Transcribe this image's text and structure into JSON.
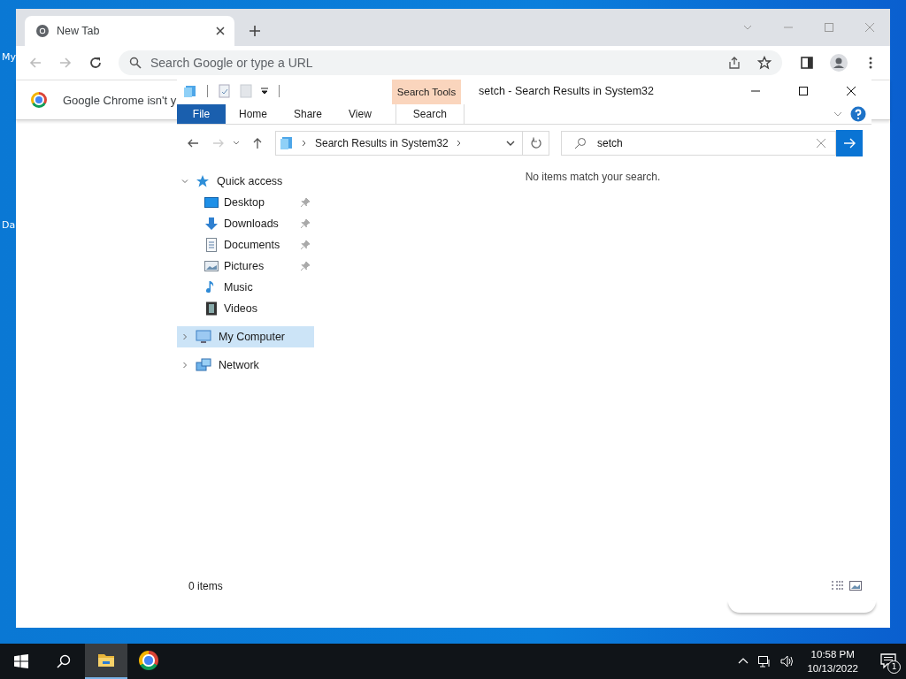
{
  "desktop": {
    "icons": [
      {
        "label": "My"
      },
      {
        "label": "Da"
      }
    ]
  },
  "chrome": {
    "tabs": [
      {
        "title": "New Tab",
        "selected": true
      }
    ],
    "omnibox": {
      "placeholder": "Search Google or type a URL"
    },
    "infobar": {
      "text": "Google Chrome isn't y"
    }
  },
  "explorer": {
    "title": "setch - Search Results in System32",
    "context_tab_group": "Search Tools",
    "ribbon_tabs": [
      {
        "label": "File",
        "kind": "file",
        "selected": false
      },
      {
        "label": "Home",
        "kind": "tab",
        "selected": false
      },
      {
        "label": "Share",
        "kind": "tab",
        "selected": false
      },
      {
        "label": "View",
        "kind": "tab",
        "selected": false
      },
      {
        "label": "Search",
        "kind": "context",
        "selected": true
      }
    ],
    "address": {
      "crumbs": [
        "Search Results in System32"
      ]
    },
    "search": {
      "value": "setch"
    },
    "nav": [
      {
        "label": "Quick access",
        "kind": "star",
        "expanded": true,
        "selected": false,
        "children": [
          {
            "label": "Desktop",
            "kind": "desktop",
            "pinned": true
          },
          {
            "label": "Downloads",
            "kind": "download",
            "pinned": true
          },
          {
            "label": "Documents",
            "kind": "document",
            "pinned": true
          },
          {
            "label": "Pictures",
            "kind": "pictures",
            "pinned": true
          },
          {
            "label": "Music",
            "kind": "music",
            "pinned": false
          },
          {
            "label": "Videos",
            "kind": "video",
            "pinned": false
          }
        ]
      },
      {
        "label": "My Computer",
        "kind": "computer",
        "expanded": false,
        "selected": true
      },
      {
        "label": "Network",
        "kind": "network",
        "expanded": false,
        "selected": false
      }
    ],
    "empty_message": "No items match your search.",
    "status": "0 items"
  },
  "taskbar": {
    "apps": [
      {
        "kind": "explorer",
        "active": true
      },
      {
        "kind": "chrome",
        "active": false
      }
    ],
    "time": "10:58 PM",
    "date": "10/13/2022",
    "notification_count": "1"
  }
}
